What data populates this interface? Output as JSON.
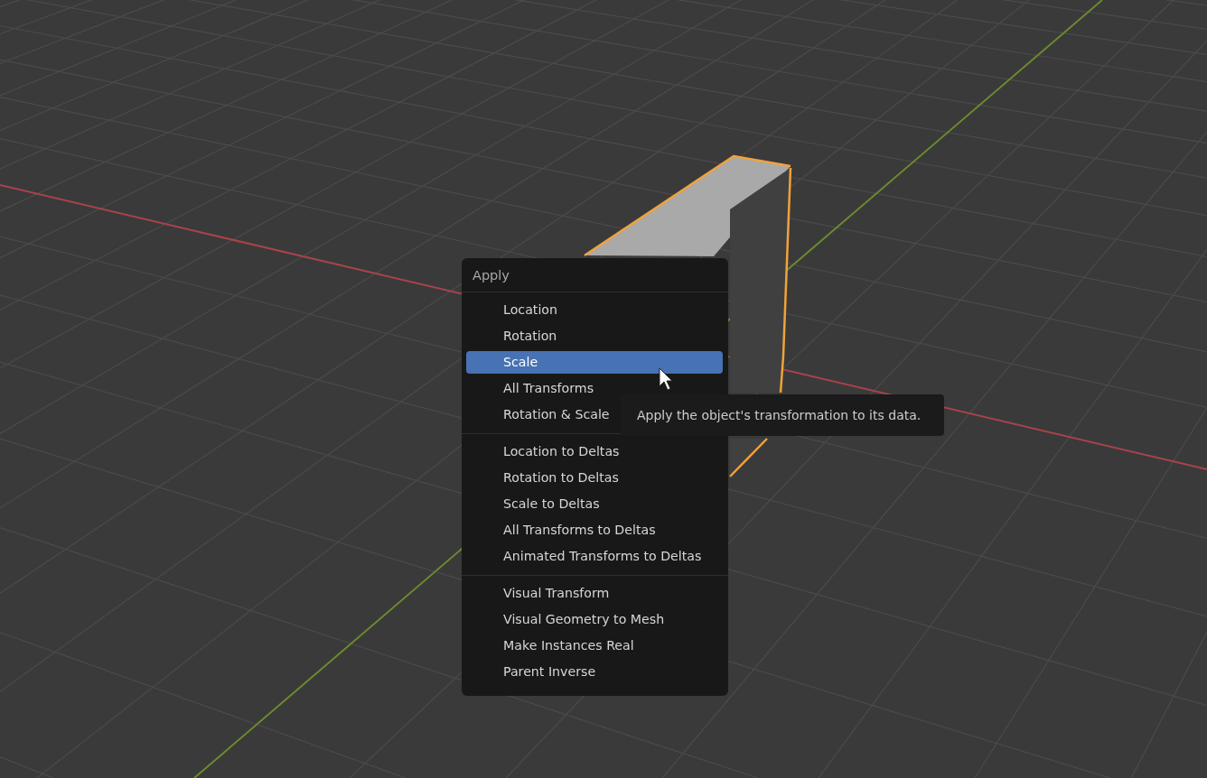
{
  "menu": {
    "title": "Apply",
    "sections": [
      {
        "items": [
          {
            "label": "Location",
            "selected": false
          },
          {
            "label": "Rotation",
            "selected": false
          },
          {
            "label": "Scale",
            "selected": true
          },
          {
            "label": "All Transforms",
            "selected": false
          },
          {
            "label": "Rotation & Scale",
            "selected": false
          }
        ]
      },
      {
        "items": [
          {
            "label": "Location to Deltas",
            "selected": false
          },
          {
            "label": "Rotation to Deltas",
            "selected": false
          },
          {
            "label": "Scale to Deltas",
            "selected": false
          },
          {
            "label": "All Transforms to Deltas",
            "selected": false
          },
          {
            "label": "Animated Transforms to Deltas",
            "selected": false
          }
        ]
      },
      {
        "items": [
          {
            "label": "Visual Transform",
            "selected": false
          },
          {
            "label": "Visual Geometry to Mesh",
            "selected": false
          },
          {
            "label": "Make Instances Real",
            "selected": false
          },
          {
            "label": "Parent Inverse",
            "selected": false
          }
        ]
      }
    ]
  },
  "tooltip": {
    "text": "Apply the object's transformation to its data."
  }
}
